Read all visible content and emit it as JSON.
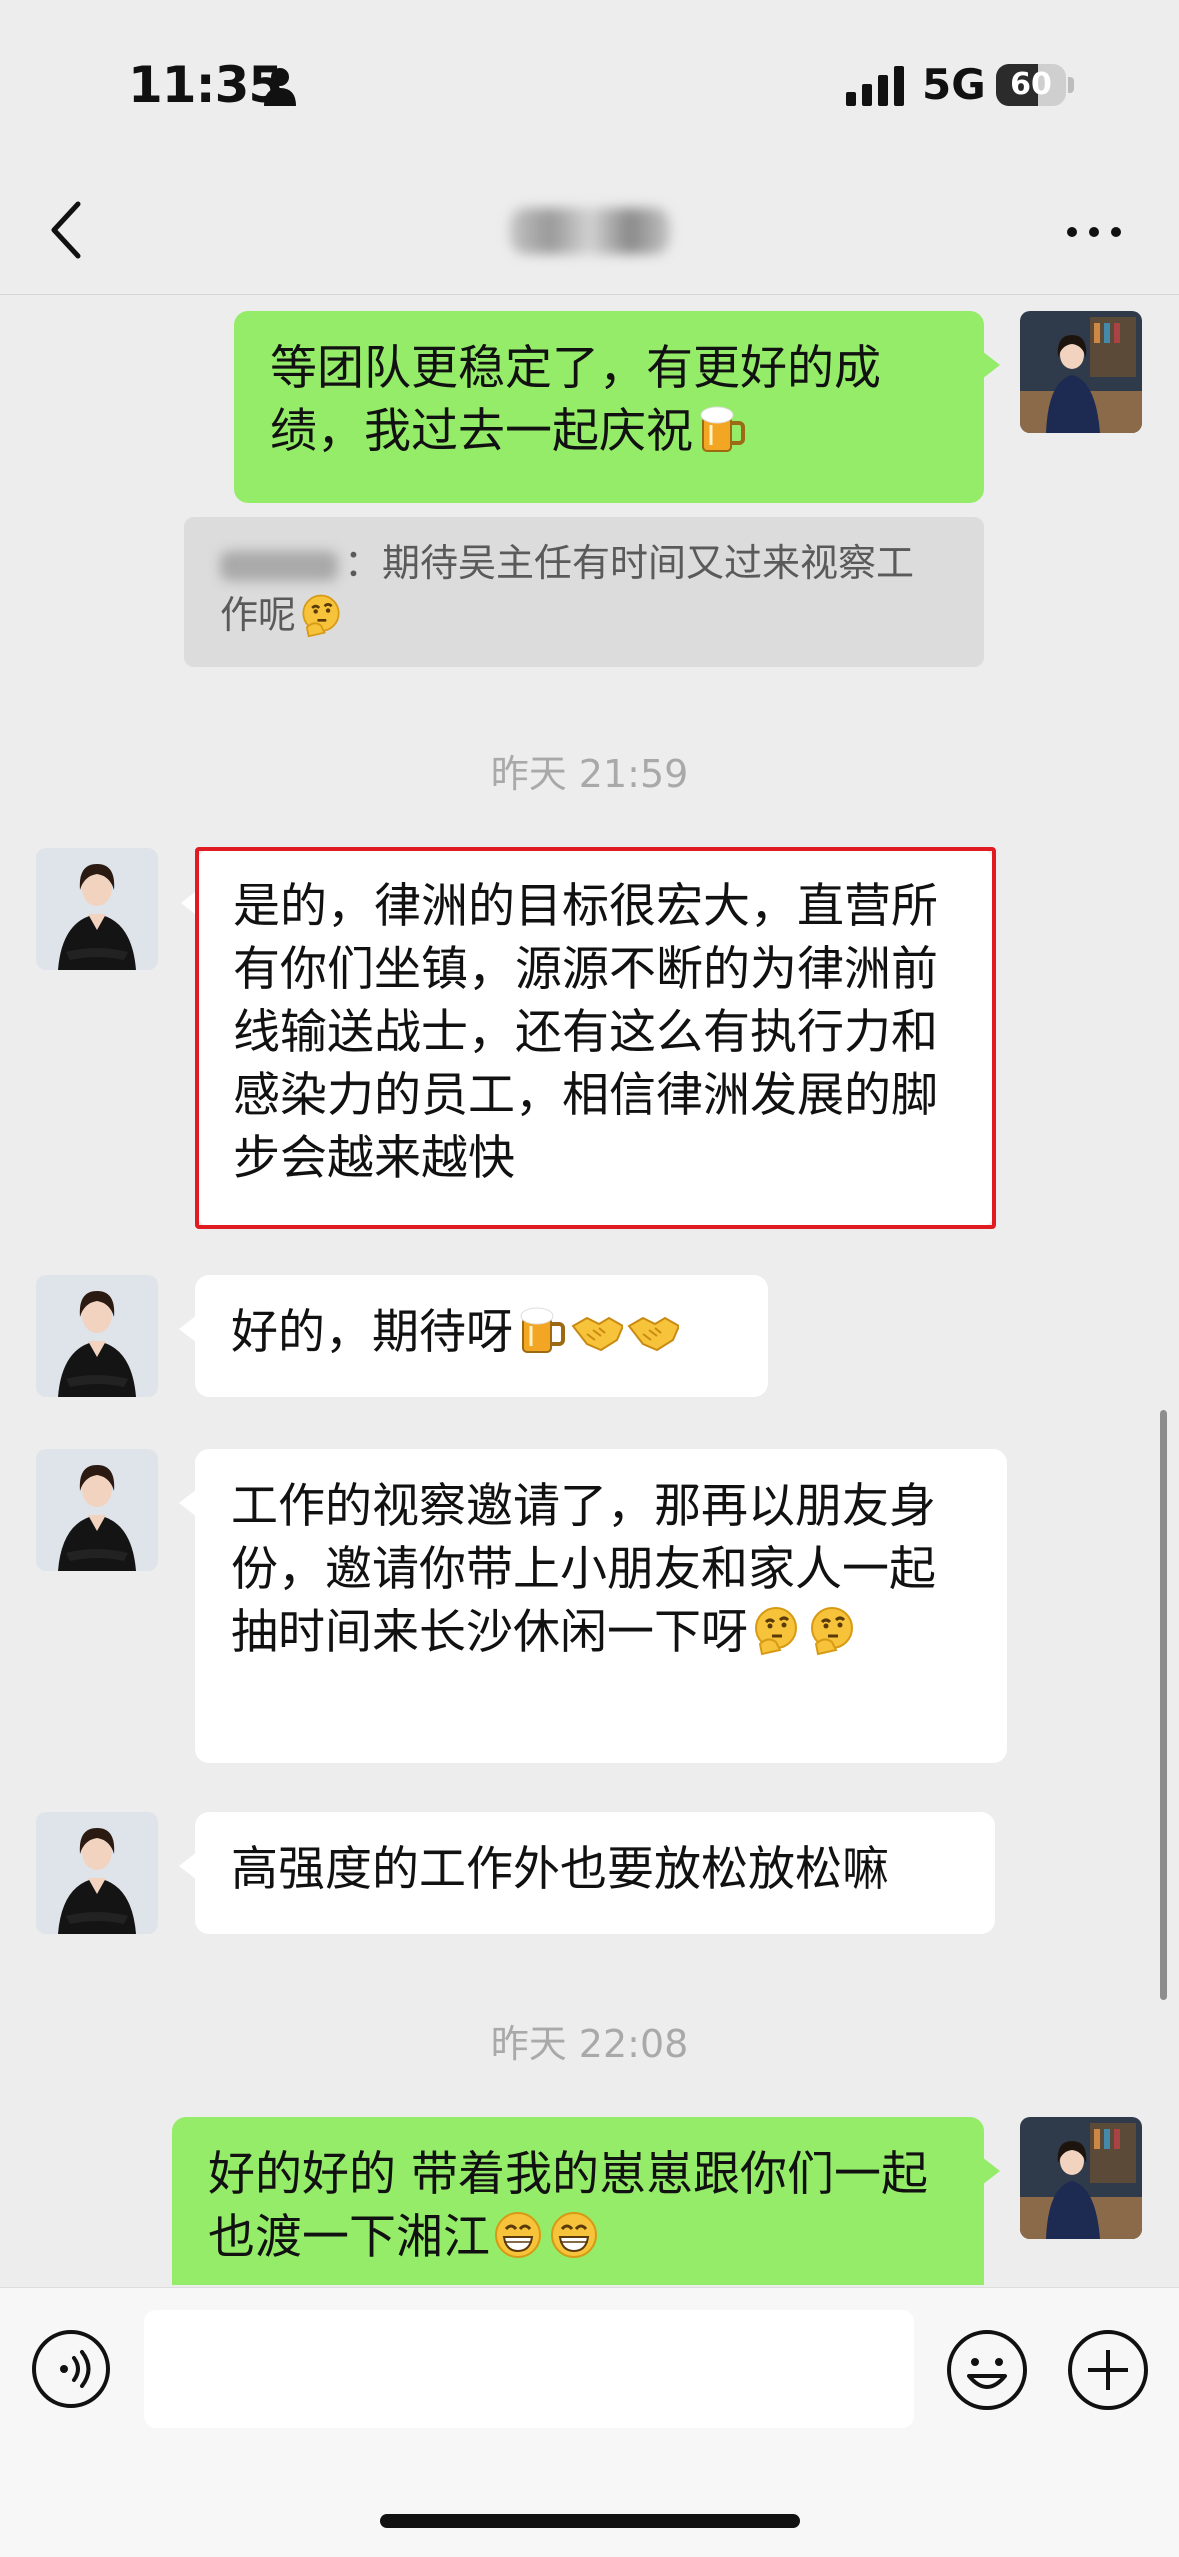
{
  "status_bar": {
    "time": "11:35",
    "network": "5G",
    "battery": "60",
    "battery_level": 0.6
  },
  "nav": {
    "title": "",
    "back_icon": "chevron-left-icon",
    "more_icon": "ellipsis-icon"
  },
  "messages": [
    {
      "type": "outgoing",
      "text": "等团队更稳定了，有更好的成绩，我过去一起庆祝",
      "emoji": [
        "beer"
      ]
    },
    {
      "type": "quote",
      "text": "：期待吴主任有时间又过来视察工作呢",
      "emoji": [
        "thinking"
      ]
    },
    {
      "type": "time",
      "text": "昨天 21:59"
    },
    {
      "type": "incoming",
      "text": "是的，律洲的目标很宏大，直营所有你们坐镇，源源不断的为律洲前线输送战士，还有这么有执行力和感染力的员工，相信律洲发展的脚步会越来越快"
    },
    {
      "type": "incoming",
      "text": "好的，期待呀",
      "emoji": [
        "beer",
        "handshake",
        "handshake"
      ]
    },
    {
      "type": "incoming",
      "text": "工作的视察邀请了，那再以朋友身份，邀请你带上小朋友和家人一起抽时间来长沙休闲一下呀",
      "emoji": [
        "thinking",
        "thinking"
      ]
    },
    {
      "type": "incoming",
      "text": "高强度的工作外也要放松放松嘛"
    },
    {
      "type": "time",
      "text": "昨天 22:08"
    },
    {
      "type": "outgoing",
      "text": "好的好的 带着我的崽崽跟你们一起也渡一下湘江",
      "emoji": [
        "grin",
        "grin"
      ]
    }
  ],
  "colors": {
    "outgoing_bubble": "#95ec69",
    "incoming_bubble": "#ffffff",
    "background": "#ededed",
    "highlight": "#e11b22"
  },
  "input_bar": {
    "placeholder": "",
    "icons": [
      "voice-icon",
      "emoji-face-icon",
      "plus-icon"
    ]
  }
}
